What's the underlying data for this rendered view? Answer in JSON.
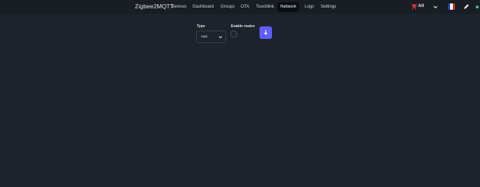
{
  "navbar": {
    "brand": "Zigbee2MQTT",
    "items": [
      {
        "label": "Devices",
        "active": false
      },
      {
        "label": "Dashboard",
        "active": false
      },
      {
        "label": "Groups",
        "active": false
      },
      {
        "label": "OTA",
        "active": false
      },
      {
        "label": "Touchlink",
        "active": false
      },
      {
        "label": "Network",
        "active": true
      },
      {
        "label": "Logs",
        "active": false
      },
      {
        "label": "Settings",
        "active": false
      }
    ],
    "coordinator_select": {
      "value": "All",
      "icon": "router-icon"
    },
    "language": {
      "icon": "french-flag-icon",
      "colors": [
        "#1f3fbf",
        "#ffffff",
        "#e0262f"
      ]
    },
    "theme_icon": "pencil-icon",
    "status_color": "#36d399"
  },
  "network": {
    "type_label": "Type",
    "type_value": "raw",
    "enable_routes_label": "Enable routes",
    "enable_routes_checked": false,
    "download_button_icon": "download-icon",
    "accent": "#605dff"
  }
}
